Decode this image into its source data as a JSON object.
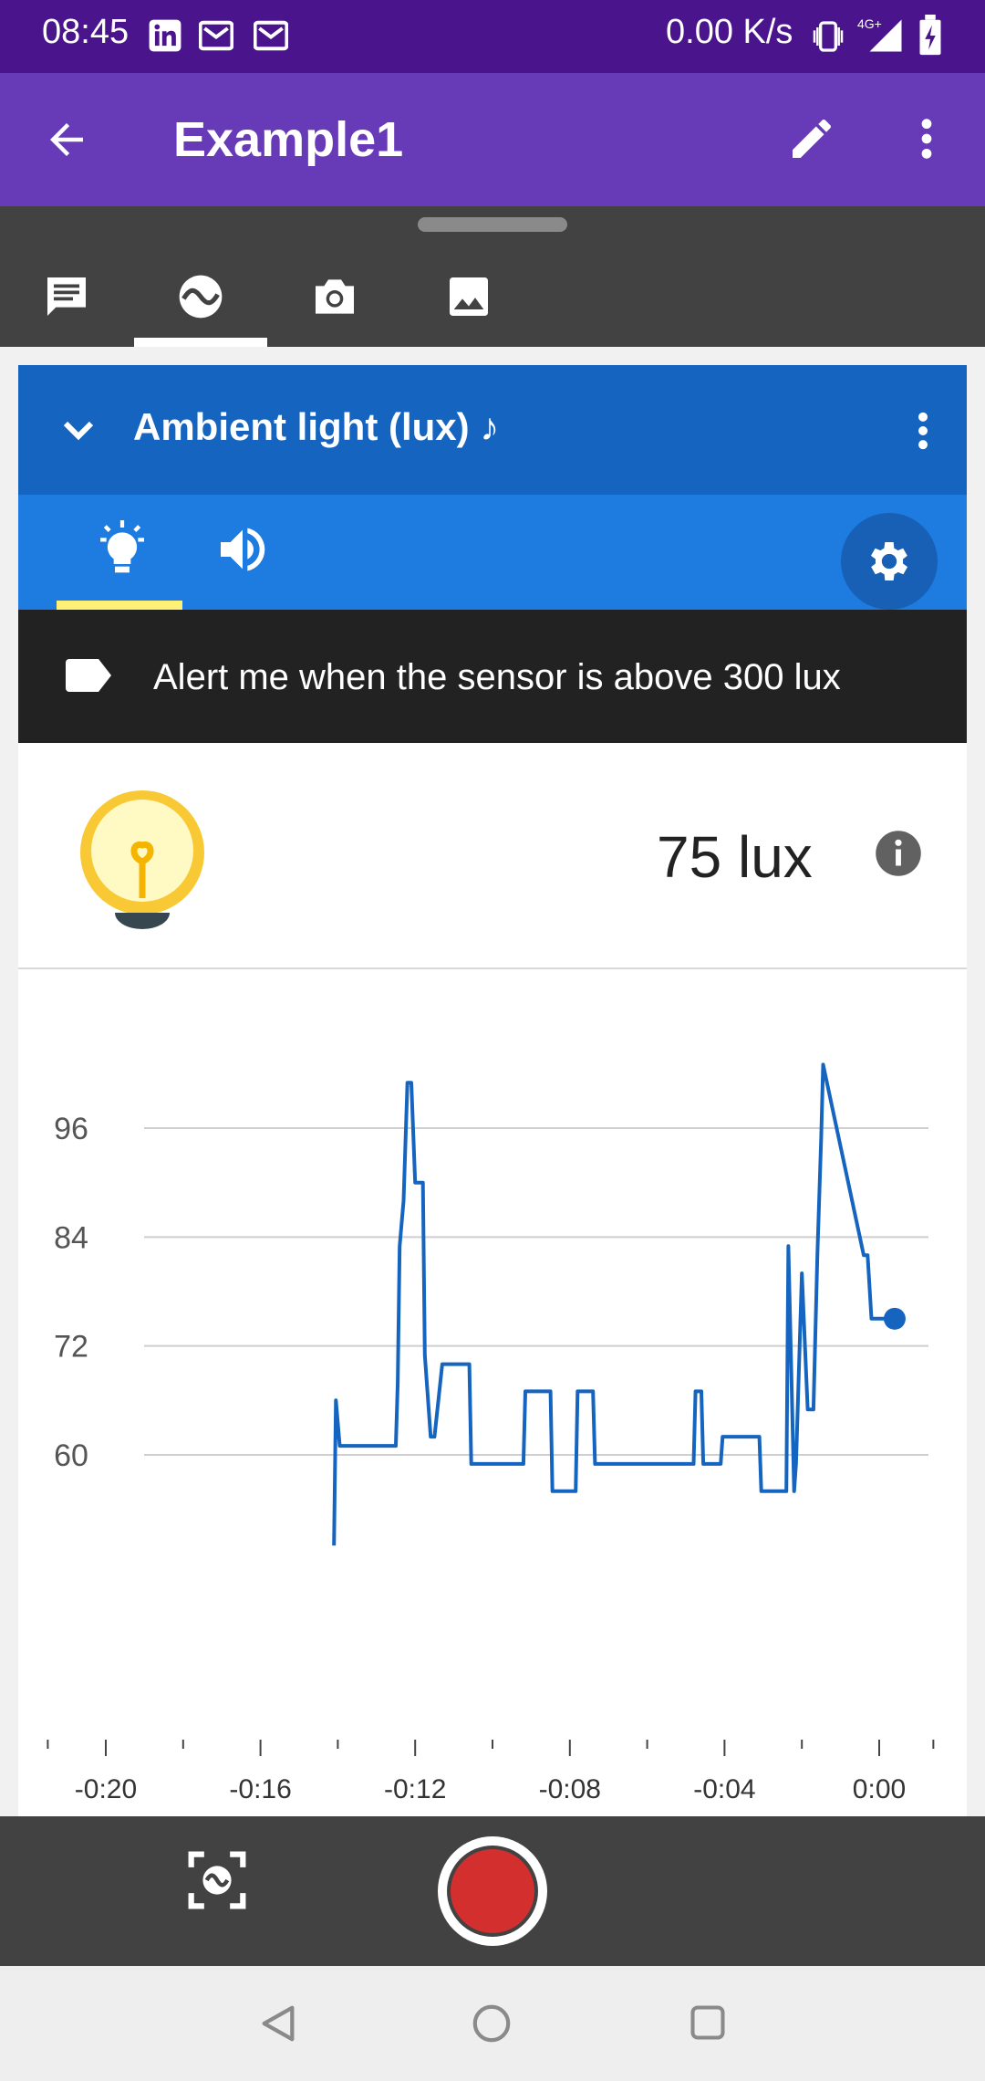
{
  "status_bar": {
    "time": "08:45",
    "net_rate": "0.00 K/s",
    "network_badge": "4G+",
    "icons": [
      "linkedin-icon",
      "gmail-icon",
      "gmail-icon",
      "vibrate-icon",
      "signal-icon",
      "battery-icon"
    ]
  },
  "app_bar": {
    "title": "Example1",
    "icons": [
      "back-arrow-icon",
      "pencil-icon",
      "more-vert-icon"
    ]
  },
  "tabs": {
    "items": [
      {
        "name": "notes",
        "icon": "note-icon"
      },
      {
        "name": "sensors",
        "icon": "sensor-wave-icon",
        "selected": true
      },
      {
        "name": "camera",
        "icon": "camera-icon"
      },
      {
        "name": "gallery",
        "icon": "image-icon"
      }
    ]
  },
  "sensor_card": {
    "title": "Ambient light (lux) ♪",
    "alert_text": "Alert me when the sensor is above 300 lux",
    "reading": "75 lux",
    "colors": {
      "header": "#1565c0",
      "tab_bar": "#1e7be0",
      "indicator": "#fff176",
      "line": "#1565c0"
    }
  },
  "chart_data": {
    "type": "line",
    "x_ticks": [
      "-0:20",
      "-0:16",
      "-0:12",
      "-0:08",
      "-0:04",
      "0:00"
    ],
    "y_ticks": [
      60,
      72,
      84,
      96
    ],
    "xlim": [
      -20,
      0.8
    ],
    "ylim": [
      49,
      104
    ],
    "grid": true,
    "series": [
      {
        "x": [
          -14.1,
          -14.05,
          -13.95,
          -13.9,
          -12.5,
          -12.45,
          -12.4,
          -12.3,
          -12.2,
          -12.1,
          -12.0,
          -11.8,
          -11.75,
          -11.6,
          -11.5,
          -11.3,
          -11.25,
          -10.6,
          -10.55,
          -9.2,
          -9.15,
          -8.5,
          -8.45,
          -7.85,
          -7.8,
          -7.4,
          -7.35,
          -6.8,
          -6.75,
          -4.8,
          -4.75,
          -4.6,
          -4.55,
          -4.1,
          -4.05,
          -3.1,
          -3.05,
          -2.4,
          -2.35,
          -2.2,
          -2.15,
          -2.0,
          -1.85,
          -1.7,
          -1.6,
          -1.5,
          -1.45,
          -0.4,
          -0.3,
          -0.2,
          -0.1,
          0.05,
          0.1,
          0.2,
          0.4
        ],
        "y": [
          50,
          66,
          61,
          61,
          61,
          68,
          83,
          88,
          101,
          101,
          90,
          90,
          71,
          62,
          62,
          70,
          70,
          70,
          59,
          59,
          67,
          67,
          56,
          56,
          67,
          67,
          59,
          59,
          59,
          59,
          67,
          67,
          59,
          59,
          62,
          62,
          56,
          56,
          83,
          56,
          59,
          80,
          65,
          65,
          82,
          95,
          103,
          82,
          82,
          75,
          75,
          75,
          75,
          75,
          75
        ]
      }
    ]
  },
  "bottom_controls": {
    "icons": [
      "snapshot-icon",
      "record-button"
    ],
    "record_color": "#d32f2f"
  },
  "nav_bar": {
    "icons": [
      "back-triangle-icon",
      "home-circle-icon",
      "recents-square-icon"
    ]
  }
}
